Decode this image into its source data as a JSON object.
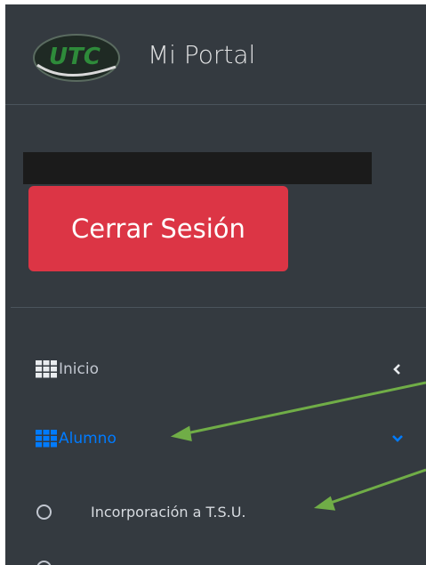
{
  "brand": {
    "title": "Mi Portal",
    "logo_text": "UTC",
    "logo_color": "#2e8b3a"
  },
  "user": {
    "name": ""
  },
  "logout": {
    "label": "Cerrar Sesión",
    "color": "#dc3545"
  },
  "nav": [
    {
      "label": "Inicio",
      "icon": "grid-icon",
      "chevron": "chevron-left-icon",
      "active": false
    },
    {
      "label": "Alumno",
      "icon": "grid-icon",
      "chevron": "chevron-down-icon",
      "active": true
    }
  ],
  "subnav": [
    {
      "label": "Incorporación a T.S.U.",
      "icon": "circle-icon"
    }
  ],
  "colors": {
    "sidebar": "#343a40",
    "active": "#007bff",
    "text": "#c2c7d0",
    "annotation": "#70ad47"
  }
}
